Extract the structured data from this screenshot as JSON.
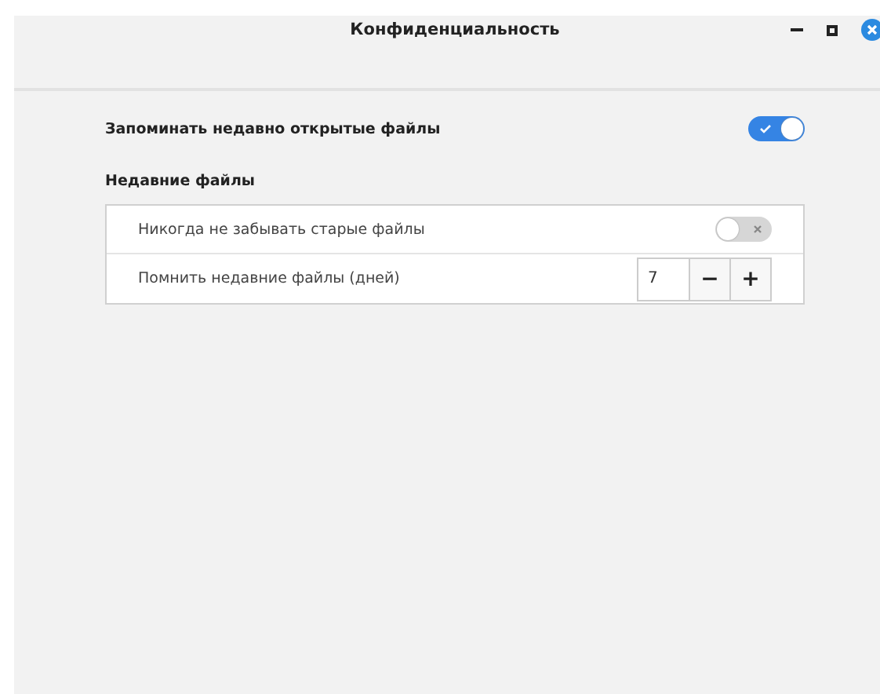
{
  "window": {
    "title": "Конфиденциальность"
  },
  "remember_recent": {
    "label": "Запоминать недавно открытые файлы",
    "on": true
  },
  "recent_files": {
    "title": "Недавние файлы",
    "rows": [
      {
        "kind": "switch",
        "label": "Никогда не забывать старые файлы",
        "on": false
      },
      {
        "kind": "spin",
        "label": "Помнить недавние файлы (дней)",
        "value": "7",
        "minus": "−",
        "plus": "+"
      }
    ]
  }
}
